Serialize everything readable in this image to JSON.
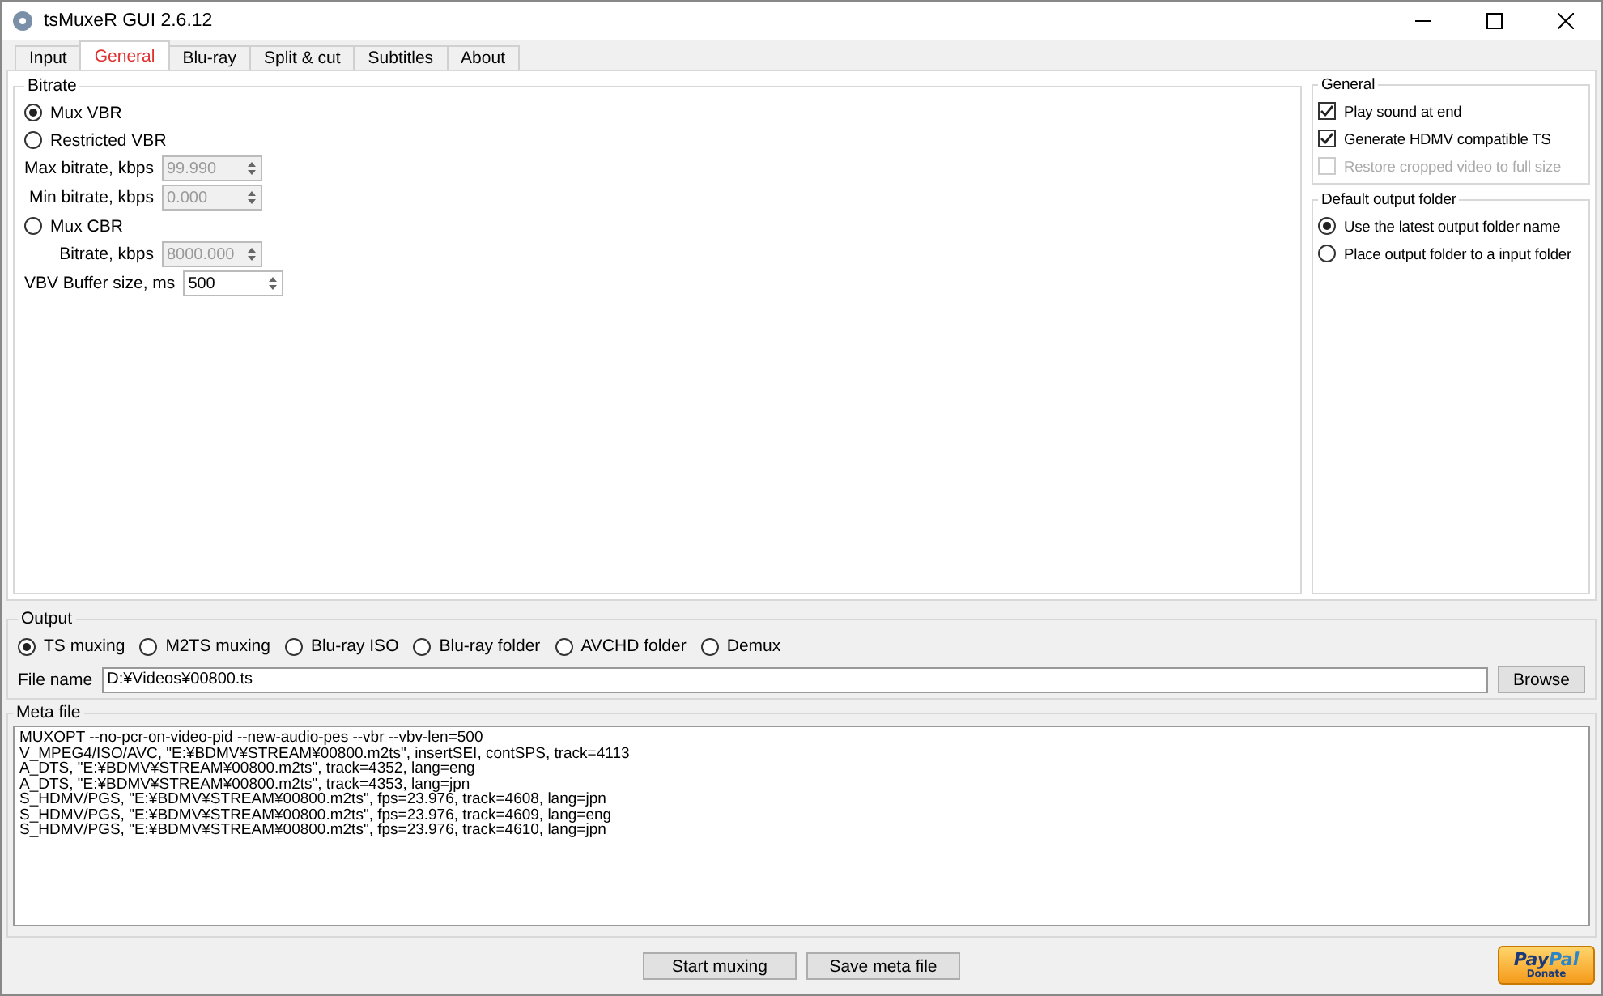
{
  "window": {
    "title": "tsMuxeR GUI 2.6.12"
  },
  "tabs": [
    {
      "label": "Input",
      "selected": false
    },
    {
      "label": "General",
      "selected": true
    },
    {
      "label": "Blu-ray",
      "selected": false
    },
    {
      "label": "Split & cut",
      "selected": false
    },
    {
      "label": "Subtitles",
      "selected": false
    },
    {
      "label": "About",
      "selected": false
    }
  ],
  "bitrate": {
    "title": "Bitrate",
    "items": [
      {
        "kind": "radio",
        "label": "Mux VBR",
        "selected": true
      },
      {
        "kind": "radio",
        "label": "Restricted VBR",
        "selected": false
      },
      {
        "kind": "spin",
        "label": "Max bitrate, kbps",
        "value": "99.990",
        "disabled": true
      },
      {
        "kind": "spin",
        "label": "Min bitrate, kbps",
        "value": "0.000",
        "disabled": true
      },
      {
        "kind": "radio",
        "label": "Mux CBR",
        "selected": false
      },
      {
        "kind": "spin",
        "label": "Bitrate, kbps",
        "value": "8000.000",
        "disabled": true
      },
      {
        "kind": "spin",
        "label": "VBV Buffer size, ms",
        "value": "500",
        "disabled": false
      }
    ]
  },
  "general": {
    "title": "General",
    "options": [
      {
        "label": "Play sound at end",
        "checked": true,
        "disabled": false
      },
      {
        "label": "Generate HDMV compatible TS",
        "checked": true,
        "disabled": false
      },
      {
        "label": "Restore cropped video to full size",
        "checked": false,
        "disabled": true
      }
    ]
  },
  "default_output_folder": {
    "title": "Default output folder",
    "options": [
      {
        "label": "Use the latest output folder name",
        "selected": true
      },
      {
        "label": "Place output folder to a input folder",
        "selected": false
      }
    ]
  },
  "output": {
    "title": "Output",
    "modes": [
      {
        "label": "TS muxing",
        "selected": true
      },
      {
        "label": "M2TS muxing",
        "selected": false
      },
      {
        "label": "Blu-ray ISO",
        "selected": false
      },
      {
        "label": "Blu-ray folder",
        "selected": false
      },
      {
        "label": "AVCHD folder",
        "selected": false
      },
      {
        "label": "Demux",
        "selected": false
      }
    ],
    "file_name_label": "File name",
    "file_name": "D:¥Videos¥00800.ts",
    "browse": "Browse"
  },
  "meta_file": {
    "title": "Meta file",
    "lines": [
      "MUXOPT --no-pcr-on-video-pid --new-audio-pes --vbr  --vbv-len=500",
      "V_MPEG4/ISO/AVC, \"E:¥BDMV¥STREAM¥00800.m2ts\", insertSEI, contSPS, track=4113",
      "A_DTS, \"E:¥BDMV¥STREAM¥00800.m2ts\", track=4352, lang=eng",
      "A_DTS, \"E:¥BDMV¥STREAM¥00800.m2ts\", track=4353, lang=jpn",
      "S_HDMV/PGS, \"E:¥BDMV¥STREAM¥00800.m2ts\", fps=23.976, track=4608, lang=jpn",
      "S_HDMV/PGS, \"E:¥BDMV¥STREAM¥00800.m2ts\", fps=23.976, track=4609, lang=eng",
      "S_HDMV/PGS, \"E:¥BDMV¥STREAM¥00800.m2ts\", fps=23.976, track=4610, lang=jpn"
    ]
  },
  "buttons": [
    "Start muxing",
    "Save meta file"
  ],
  "donate": {
    "brand_a": "Pay",
    "brand_b": "Pal",
    "label": "Donate"
  }
}
